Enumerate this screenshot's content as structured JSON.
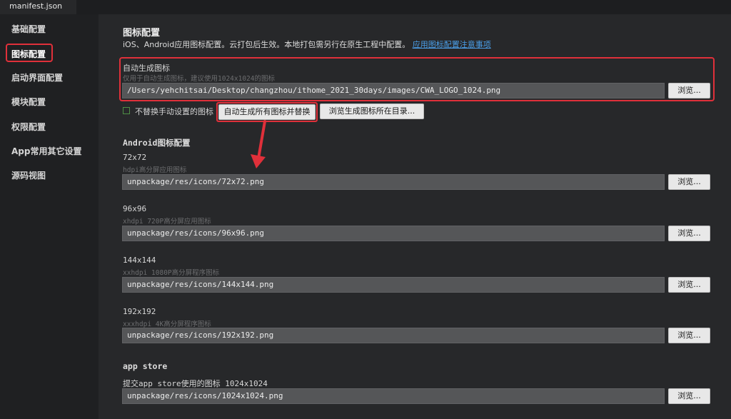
{
  "tab": {
    "label": "manifest.json"
  },
  "sidebar": {
    "items": [
      {
        "label": "基础配置"
      },
      {
        "label": "图标配置"
      },
      {
        "label": "启动界面配置"
      },
      {
        "label": "模块配置"
      },
      {
        "label": "权限配置"
      },
      {
        "label": "App常用其它设置"
      },
      {
        "label": "源码视图"
      }
    ],
    "active_index": 1
  },
  "page": {
    "title": "图标配置",
    "description": "iOS、Android应用图标配置。云打包后生效。本地打包需另行在原生工程中配置。",
    "description_link": "应用图标配置注意事项"
  },
  "auto_icon": {
    "label": "自动生成图标",
    "hint": "仅用于自动生成图标，建议使用1024x1024的图标",
    "value": "/Users/yehchitsai/Desktop/changzhou/ithome_2021_30days/images/CWA_LOGO_1024.png",
    "browse_label": "浏览..."
  },
  "options": {
    "no_replace_label": "不替换手动设置的图标",
    "no_replace_checked": false,
    "generate_button": "自动生成所有图标并替换",
    "browse_dir_button": "浏览生成图标所在目录..."
  },
  "android": {
    "section_title": "Android图标配置",
    "icons": [
      {
        "label": "72x72",
        "hint": "hdpi高分屏应用图标",
        "value": "unpackage/res/icons/72x72.png",
        "browse_label": "浏览..."
      },
      {
        "label": "96x96",
        "hint": "xhdpi 720P高分屏应用图标",
        "value": "unpackage/res/icons/96x96.png",
        "browse_label": "浏览..."
      },
      {
        "label": "144x144",
        "hint": "xxhdpi 1080P高分屏程序图标",
        "value": "unpackage/res/icons/144x144.png",
        "browse_label": "浏览..."
      },
      {
        "label": "192x192",
        "hint": "xxxhdpi 4K高分屏程序图标",
        "value": "unpackage/res/icons/192x192.png",
        "browse_label": "浏览..."
      }
    ]
  },
  "appstore": {
    "section_title": "app store",
    "label": "提交app store使用的图标 1024x1024",
    "value": "unpackage/res/icons/1024x1024.png",
    "browse_label": "浏览..."
  },
  "colors": {
    "highlight": "#e0303a",
    "link": "#4a9ee8",
    "background": "#27282a"
  }
}
